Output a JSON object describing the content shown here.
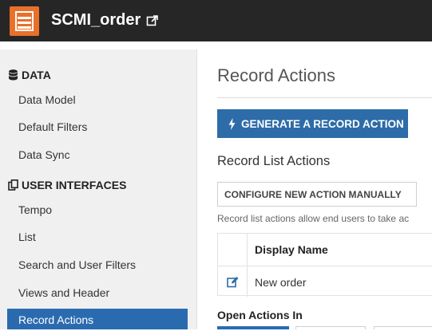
{
  "header": {
    "app_title": "SCMI_order",
    "app_icon": "record-type-icon",
    "external_link_icon": "external-link-icon",
    "colors": {
      "bar": "#262626",
      "icon": "#e8702a"
    }
  },
  "sidebar": {
    "sections": [
      {
        "title": "DATA",
        "icon": "database-icon",
        "items": [
          "Data Model",
          "Default Filters",
          "Data Sync"
        ]
      },
      {
        "title": "USER INTERFACES",
        "icon": "copy-icon",
        "items": [
          "Tempo",
          "List",
          "Search and User Filters",
          "Views and Header",
          "Record Actions"
        ]
      }
    ],
    "active_item": "Record Actions",
    "colors": {
      "active": "#2a6bb0"
    }
  },
  "main": {
    "title": "Record Actions",
    "generate_button": "GENERATE A RECORD ACTION",
    "list_actions_title": "Record List Actions",
    "configure_button": "CONFIGURE NEW ACTION MANUALLY",
    "help_text": "Record list actions allow end users to take ac",
    "table": {
      "columns": [
        "Display Name"
      ],
      "rows": [
        {
          "display_name": "New order"
        }
      ]
    },
    "open_actions_label": "Open Actions In",
    "colors": {
      "primary": "#2d6ca8"
    }
  }
}
